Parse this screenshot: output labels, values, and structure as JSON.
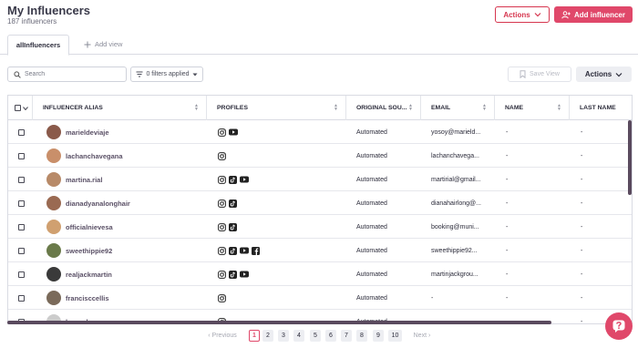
{
  "header": {
    "title": "My Influencers",
    "subtitle": "187 influencers",
    "actions_label": "Actions",
    "add_label": "Add influencer"
  },
  "tabs": {
    "active": "allInfluencers",
    "add": "Add view"
  },
  "toolbar": {
    "search_placeholder": "Search",
    "filters_label": "0 filters applied",
    "save_view_label": "Save View",
    "actions_label": "Actions"
  },
  "table": {
    "columns": [
      "INFLUENCER ALIAS",
      "PROFILES",
      "ORIGINAL SOU...",
      "EMAIL",
      "NAME",
      "LAST NAME"
    ],
    "rows": [
      {
        "alias": "marieldeviaje",
        "profiles": [
          "instagram",
          "youtube"
        ],
        "source": "Automated",
        "email": "yosoy@marield...",
        "name": "-",
        "last": "-",
        "avatar": "#8a5a4a"
      },
      {
        "alias": "lachanchavegana",
        "profiles": [
          "instagram"
        ],
        "source": "Automated",
        "email": "lachanchavega...",
        "name": "-",
        "last": "-",
        "avatar": "#c98f6a"
      },
      {
        "alias": "martina.rial",
        "profiles": [
          "instagram",
          "tiktok",
          "youtube"
        ],
        "source": "Automated",
        "email": "martirial@gmail...",
        "name": "-",
        "last": "-",
        "avatar": "#b88a68"
      },
      {
        "alias": "dianadyanalonghair",
        "profiles": [
          "instagram",
          "tiktok"
        ],
        "source": "Automated",
        "email": "dianahairlong@...",
        "name": "-",
        "last": "-",
        "avatar": "#9a6a52"
      },
      {
        "alias": "officialnievesa",
        "profiles": [
          "instagram",
          "tiktok"
        ],
        "source": "Automated",
        "email": "booking@muni...",
        "name": "-",
        "last": "-",
        "avatar": "#d0a070"
      },
      {
        "alias": "sweethippie92",
        "profiles": [
          "instagram",
          "tiktok",
          "youtube",
          "facebook"
        ],
        "source": "Automated",
        "email": "sweethippie92...",
        "name": "-",
        "last": "-",
        "avatar": "#6a7a4a"
      },
      {
        "alias": "realjackmartin",
        "profiles": [
          "instagram",
          "tiktok",
          "youtube"
        ],
        "source": "Automated",
        "email": "martinjackgrou...",
        "name": "-",
        "last": "-",
        "avatar": "#3a3a3a"
      },
      {
        "alias": "francisccellis",
        "profiles": [
          "instagram"
        ],
        "source": "Automated",
        "email": "-",
        "name": "-",
        "last": "-",
        "avatar": "#7a6a5a"
      },
      {
        "alias": "luxuryhomes",
        "profiles": [
          "instagram"
        ],
        "source": "Automated",
        "email": "-",
        "name": "-",
        "last": "-",
        "avatar": "#cccccc"
      }
    ]
  },
  "pagination": {
    "previous": "Previous",
    "next": "Next",
    "pages": [
      "1",
      "2",
      "3",
      "4",
      "5",
      "6",
      "7",
      "8",
      "9",
      "10"
    ],
    "current": "1"
  },
  "colors": {
    "brand": "#e0486a",
    "scrollbar": "#5a4a5e"
  }
}
